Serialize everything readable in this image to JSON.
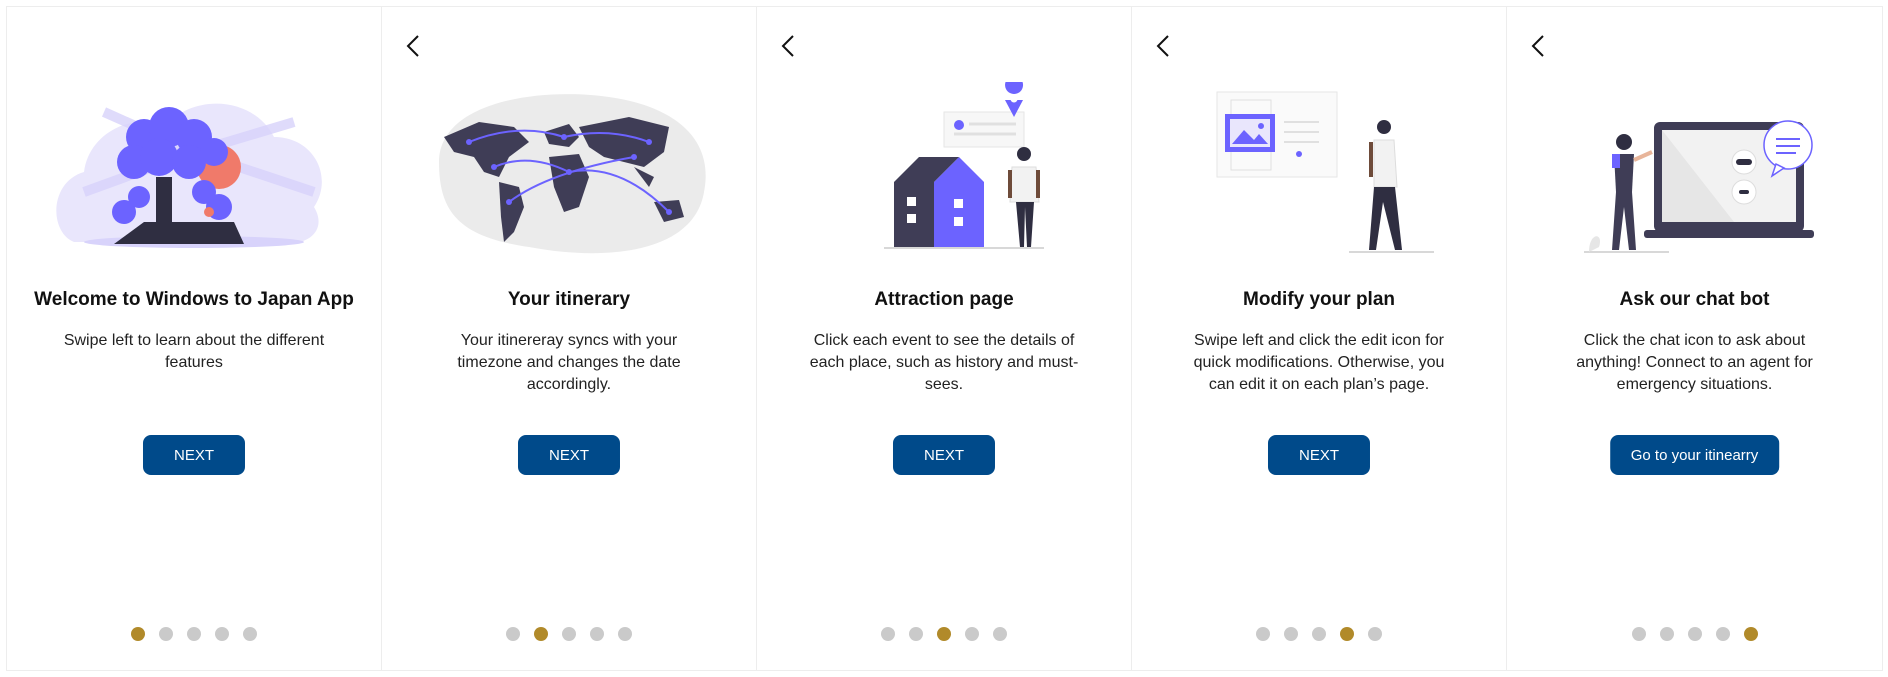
{
  "screens": [
    {
      "title": "Welcome to Windows to Japan App",
      "description": "Swipe left to learn about the different features",
      "button": "NEXT",
      "has_back": false,
      "illustration": "tree-meditation-illustration",
      "active_dot": 0
    },
    {
      "title": "Your itinerary",
      "description": "Your itinereray syncs with your timezone and changes the date accordingly.",
      "button": "NEXT",
      "has_back": true,
      "illustration": "world-map-illustration",
      "active_dot": 1
    },
    {
      "title": "Attraction page",
      "description": "Click each event to see the details of each place, such as history and must-sees.",
      "button": "NEXT",
      "has_back": true,
      "illustration": "house-location-illustration",
      "active_dot": 2
    },
    {
      "title": "Modify your plan",
      "description": "Swipe left and click the edit icon for quick modifications. Otherwise, you can edit it on each plan’s page.",
      "button": "NEXT",
      "has_back": true,
      "illustration": "edit-image-illustration",
      "active_dot": 3
    },
    {
      "title": "Ask our chat bot",
      "description": "Click the chat icon to ask about anything! Connect to an agent for emergency situations.",
      "button": "Go to your itinearry",
      "has_back": true,
      "illustration": "chat-bot-illustration",
      "active_dot": 4
    }
  ],
  "dot_count": 5,
  "colors": {
    "button": "#004a8a",
    "dot_active": "#b18a2a",
    "dot_inactive": "#cacaca",
    "accent_purple": "#6c63ff",
    "dark_figure": "#3f3d56"
  },
  "icons": {
    "back": "chevron-left-icon"
  }
}
